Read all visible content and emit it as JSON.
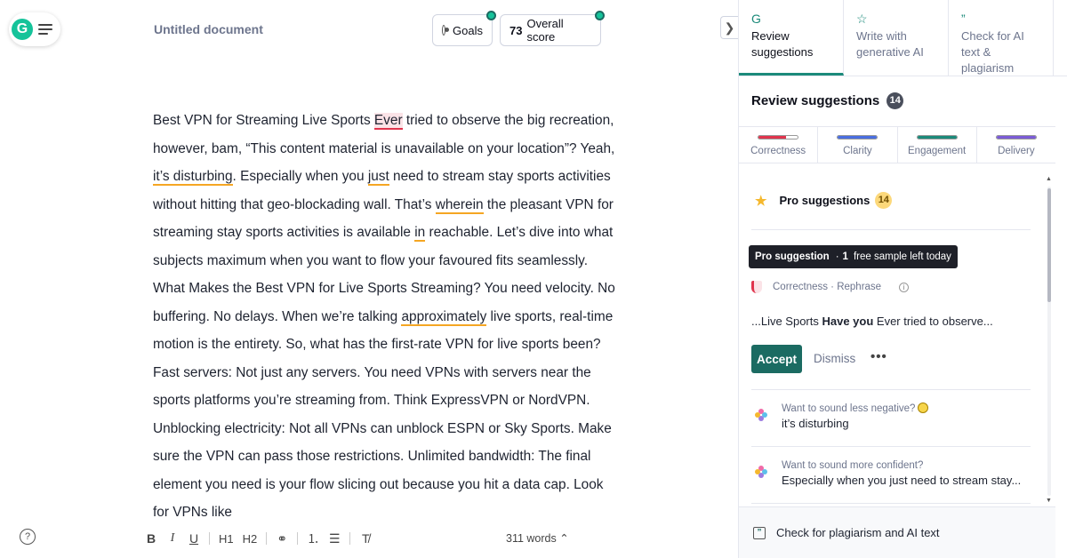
{
  "app": {
    "logo_letter": "G"
  },
  "header": {
    "doc_title": "Untitled document",
    "goals_label": "Goals",
    "score_value": "73",
    "score_label": "Overall score"
  },
  "document": {
    "segments": [
      {
        "t": "Best VPN for Streaming Live Sports "
      },
      {
        "t": "Ever",
        "mark": "red"
      },
      {
        "t": " tried to observe the big recreation, however, bam, “This content material is unavailable on your location”? Yeah, "
      },
      {
        "t": "it’s disturbing",
        "mark": "orange"
      },
      {
        "t": ". Especially when you "
      },
      {
        "t": "just",
        "mark": "orange"
      },
      {
        "t": " need to stream stay sports activities without hitting that geo-blockading wall. That’s "
      },
      {
        "t": "wherein",
        "mark": "orange"
      },
      {
        "t": " the pleasant VPN for streaming stay sports activities is available "
      },
      {
        "t": "in",
        "mark": "orange"
      },
      {
        "t": " reachable. Let’s dive into what subjects maximum when you want to flow your favoured fits seamlessly. What Makes the Best VPN for Live Sports Streaming? You need velocity. No buffering. No delays. When we’re talking "
      },
      {
        "t": "approximately",
        "mark": "orange"
      },
      {
        "t": " live sports, real-time motion is the entirety. So, what has the first-rate VPN for live sports been? Fast servers: Not just any servers. You need VPNs with servers near the sports platforms you’re streaming from. Think ExpressVPN or NordVPN. Unblocking electricity: Not all VPNs can unblock ESPN or Sky Sports. Make sure the VPN can pass those restrictions. Unlimited bandwidth: The final element you need is your flow slicing out because you hit a data cap. Look for VPNs like"
      }
    ]
  },
  "toolbar": {
    "bold": "B",
    "italic": "I",
    "underline": "U",
    "h1": "H1",
    "h2": "H2",
    "link": "⚭",
    "ol": "⒈",
    "ul": "☰",
    "clear": "T̸",
    "word_count": "311 words ⌃"
  },
  "panel": {
    "tabs": [
      {
        "label": "Review suggestions",
        "icon": "G",
        "active": true
      },
      {
        "label": "Write with generative AI",
        "icon": "☆",
        "active": false
      },
      {
        "label": "Check for AI text & plagiarism",
        "icon": "”",
        "active": false
      }
    ],
    "review_title": "Review suggestions",
    "review_count": "14",
    "categories": [
      {
        "label": "Correctness",
        "color": "#e0344d",
        "fill": 0.7
      },
      {
        "label": "Clarity",
        "color": "#4a6ee0",
        "fill": 1.0
      },
      {
        "label": "Engagement",
        "color": "#1b8a7a",
        "fill": 1.0
      },
      {
        "label": "Delivery",
        "color": "#7b5cd6",
        "fill": 1.0
      }
    ],
    "pro_label": "Pro suggestions",
    "pro_count": "14",
    "tooltip_bold": "Pro suggestion",
    "tooltip_sep": "·",
    "tooltip_count": "1",
    "tooltip_rest": "free sample left today",
    "corr_label": "Correctness · Rephrase",
    "snippet_pre": "...Live Sports ",
    "snippet_bold": "Have you",
    "snippet_post": " Ever tried to observe...",
    "accept": "Accept",
    "dismiss": "Dismiss",
    "more": "•••",
    "suggestions": [
      {
        "question": "Want to sound less negative?",
        "text": "it’s disturbing",
        "emoji": true
      },
      {
        "question": "Want to sound more confident?",
        "text": "Especially when you just need to stream stay...",
        "emoji": false
      }
    ],
    "footer_label": "Check for plagiarism and AI text",
    "footer_icon": "”"
  },
  "left": {
    "help": "?"
  }
}
